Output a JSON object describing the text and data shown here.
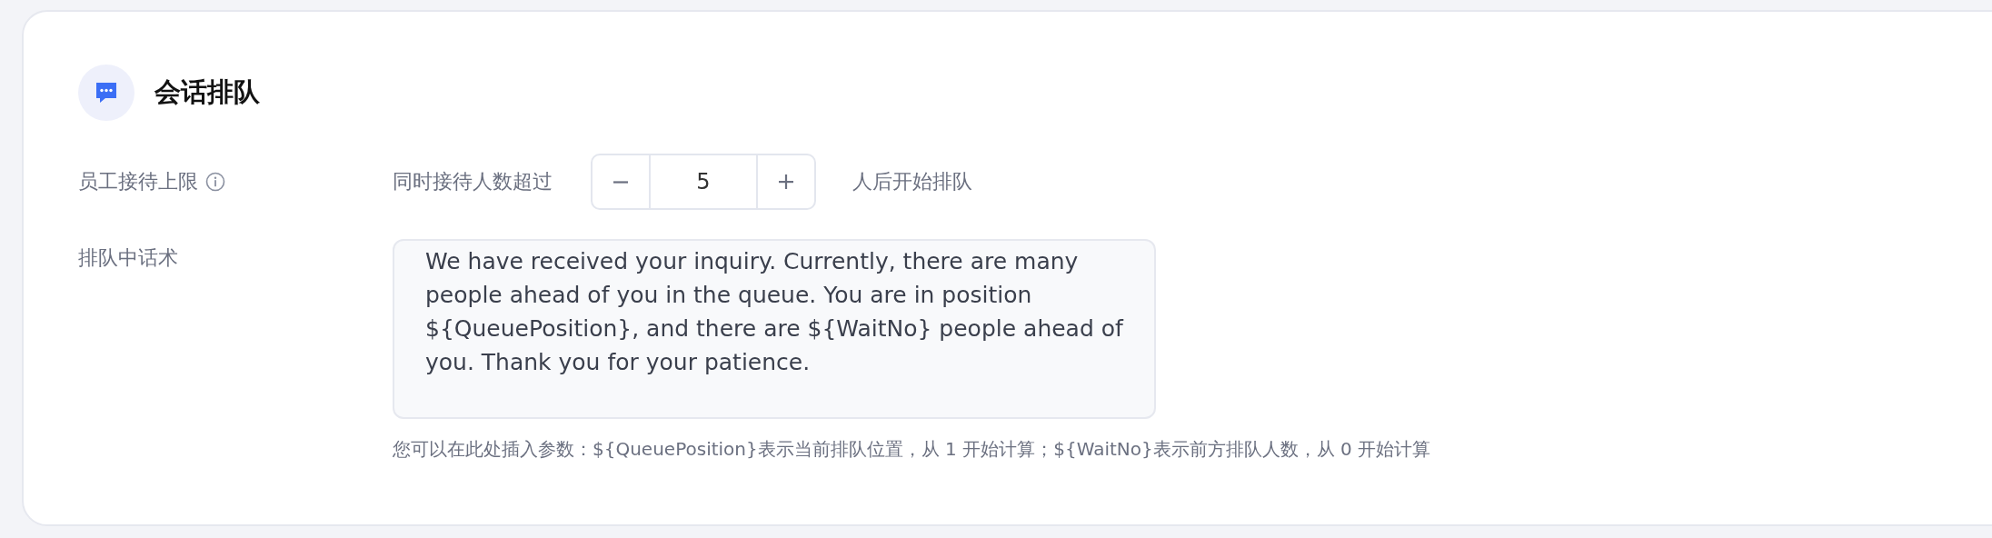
{
  "section": {
    "title": "会话排队"
  },
  "limit_row": {
    "label": "员工接待上限",
    "prefix": "同时接待人数超过",
    "value": "5",
    "suffix": "人后开始排队"
  },
  "message_row": {
    "label": "排队中话术",
    "value": "We have received your inquiry. Currently, there are many people ahead of you in the queue. You are in position ${QueuePosition}, and there are ${WaitNo} people ahead of you. Thank you for your patience.",
    "hint": "您可以在此处插入参数：${QueuePosition}表示当前排队位置，从 1 开始计算；${WaitNo}表示前方排队人数，从 0 开始计算"
  }
}
